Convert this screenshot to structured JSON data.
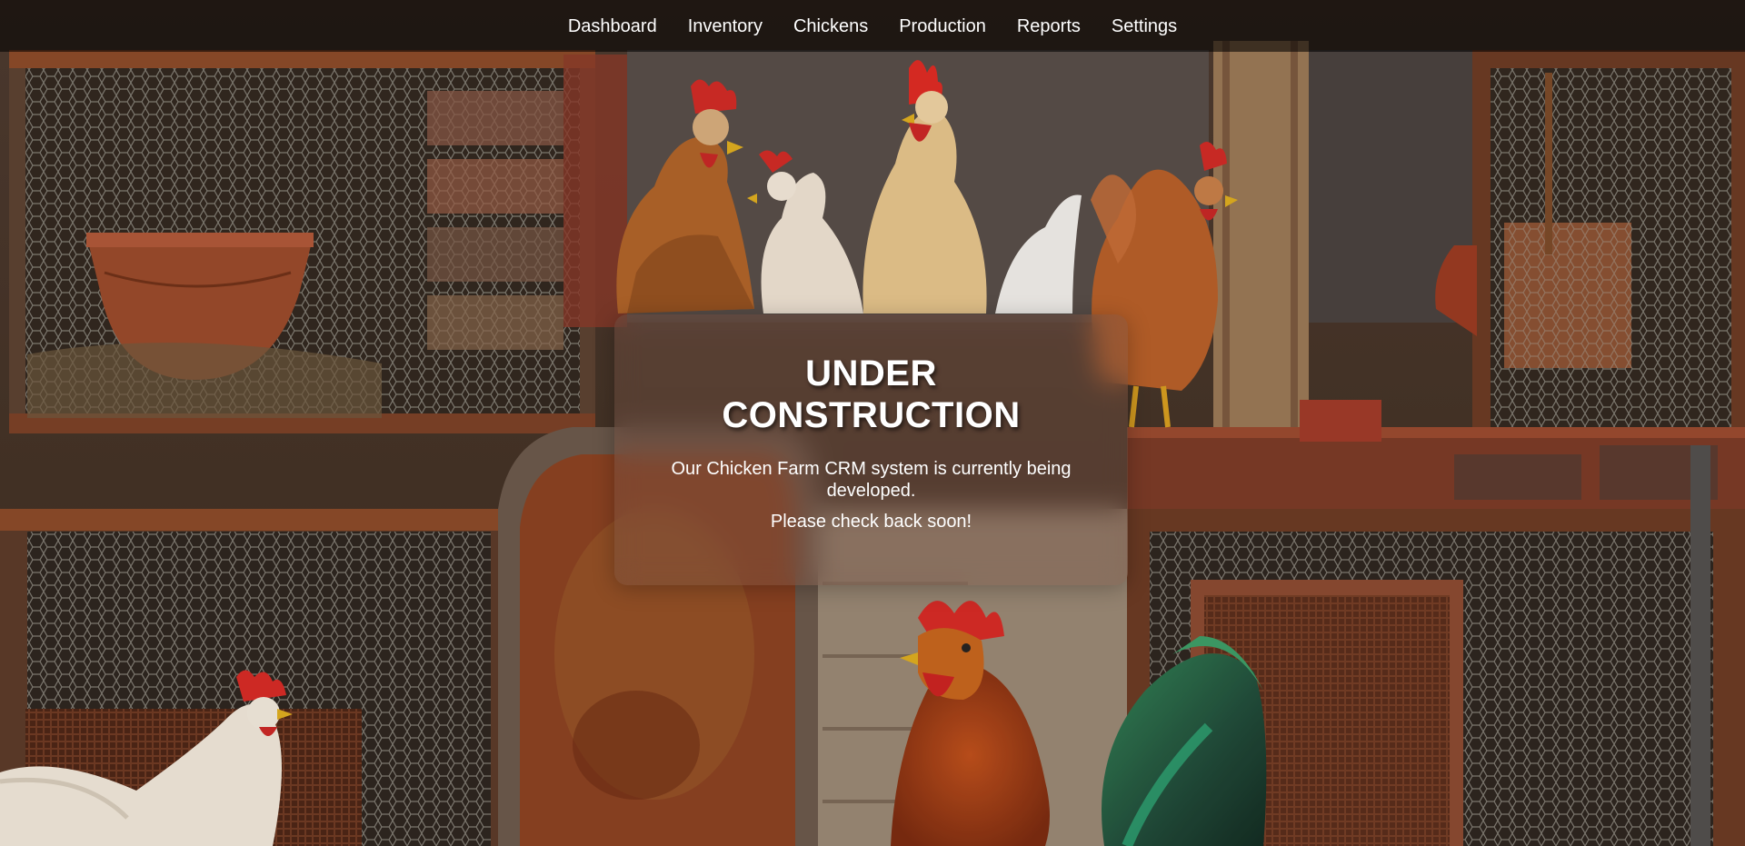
{
  "nav": {
    "items": [
      {
        "label": "Dashboard"
      },
      {
        "label": "Inventory"
      },
      {
        "label": "Chickens"
      },
      {
        "label": "Production"
      },
      {
        "label": "Reports"
      },
      {
        "label": "Settings"
      }
    ]
  },
  "notice": {
    "title": "UNDER CONSTRUCTION",
    "message": "Our Chicken Farm CRM system is currently being developed.",
    "note": "Please check back soon!"
  },
  "colors": {
    "nav_text": "#ffffff",
    "card_text": "#ffffff",
    "rust": "#8a4a28",
    "comb_red": "#c8262a"
  }
}
